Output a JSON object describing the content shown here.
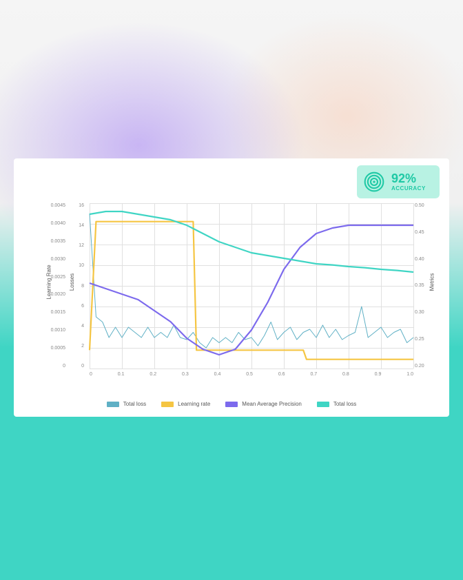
{
  "accuracy": {
    "value": "92%",
    "label": "ACCURACY"
  },
  "axes": {
    "learning_rate_title": "Learning Rate",
    "losses_title": "Losses",
    "metrics_title": "Metrics",
    "learning_rate_ticks": [
      "0.0045",
      "0.0040",
      "0.0035",
      "0.0030",
      "0.0025",
      "0.0020",
      "0.0015",
      "0.0010",
      "0.0005",
      "0"
    ],
    "losses_ticks": [
      "16",
      "14",
      "12",
      "10",
      "8",
      "6",
      "4",
      "2",
      "0"
    ],
    "metrics_ticks": [
      "0.50",
      "0.45",
      "0.40",
      "0.35",
      "0.30",
      "0.25",
      "0.20"
    ],
    "x_ticks": [
      "0",
      "0.1",
      "0.2",
      "0.3",
      "0.4",
      "0.5",
      "0.6",
      "0.7",
      "0.8",
      "0.9",
      "1.0"
    ]
  },
  "legend": {
    "items": [
      {
        "label": "Total  loss",
        "color": "#5fb0c5"
      },
      {
        "label": "Learning rate",
        "color": "#f5c542"
      },
      {
        "label": "Mean Average Precision",
        "color": "#7c6aed"
      },
      {
        "label": "Total loss",
        "color": "#3fd5c4"
      }
    ]
  },
  "chart_data": {
    "type": "line",
    "xlabel": "",
    "xlim": [
      0,
      1.0
    ],
    "axes_config": [
      {
        "name": "Learning Rate",
        "side": "left-outer",
        "range": [
          0,
          0.0045
        ]
      },
      {
        "name": "Losses",
        "side": "left-inner",
        "range": [
          0,
          16
        ]
      },
      {
        "name": "Metrics",
        "side": "right",
        "range": [
          0.2,
          0.5
        ]
      }
    ],
    "series": [
      {
        "name": "Total  loss",
        "axis": "Losses",
        "color": "#5fb0c5",
        "x": [
          0,
          0.02,
          0.04,
          0.06,
          0.08,
          0.1,
          0.12,
          0.14,
          0.16,
          0.18,
          0.2,
          0.22,
          0.24,
          0.26,
          0.28,
          0.3,
          0.32,
          0.34,
          0.36,
          0.38,
          0.4,
          0.42,
          0.44,
          0.46,
          0.48,
          0.5,
          0.52,
          0.54,
          0.56,
          0.58,
          0.6,
          0.62,
          0.64,
          0.66,
          0.68,
          0.7,
          0.72,
          0.74,
          0.76,
          0.78,
          0.8,
          0.82,
          0.84,
          0.86,
          0.88,
          0.9,
          0.92,
          0.94,
          0.96,
          0.98,
          1.0
        ],
        "values": [
          15,
          5,
          4.5,
          3,
          4,
          3,
          4,
          3.5,
          3,
          4,
          3,
          3.5,
          3,
          4.2,
          3,
          2.8,
          3.5,
          2.5,
          2,
          3,
          2.5,
          3,
          2.5,
          3.5,
          2.8,
          3,
          2.2,
          3.2,
          4.5,
          2.8,
          3.5,
          4,
          2.8,
          3.5,
          3.8,
          3,
          4.2,
          3,
          3.8,
          2.8,
          3.2,
          3.5,
          6,
          3,
          3.5,
          4,
          3,
          3.5,
          3.8,
          2.5,
          3
        ]
      },
      {
        "name": "Learning rate",
        "axis": "Learning Rate",
        "color": "#f5c542",
        "x": [
          0,
          0.02,
          0.32,
          0.33,
          0.66,
          0.67,
          1.0
        ],
        "values": [
          0.0005,
          0.004,
          0.004,
          0.0005,
          0.0005,
          0.00025,
          0.00025
        ]
      },
      {
        "name": "Mean Average Precision",
        "axis": "Metrics",
        "color": "#7c6aed",
        "x": [
          0,
          0.05,
          0.1,
          0.15,
          0.2,
          0.25,
          0.3,
          0.35,
          0.4,
          0.45,
          0.5,
          0.55,
          0.6,
          0.65,
          0.7,
          0.75,
          0.8,
          0.85,
          0.9,
          0.95,
          1.0
        ],
        "values": [
          0.355,
          0.345,
          0.335,
          0.325,
          0.305,
          0.285,
          0.255,
          0.235,
          0.225,
          0.235,
          0.27,
          0.32,
          0.38,
          0.42,
          0.445,
          0.455,
          0.46,
          0.46,
          0.46,
          0.46,
          0.46
        ]
      },
      {
        "name": "Total loss",
        "axis": "Metrics",
        "color": "#3fd5c4",
        "x": [
          0,
          0.05,
          0.1,
          0.15,
          0.2,
          0.25,
          0.3,
          0.35,
          0.4,
          0.45,
          0.5,
          0.55,
          0.6,
          0.65,
          0.7,
          0.75,
          0.8,
          0.85,
          0.9,
          0.95,
          1.0
        ],
        "values": [
          0.48,
          0.485,
          0.485,
          0.48,
          0.475,
          0.47,
          0.46,
          0.445,
          0.43,
          0.42,
          0.41,
          0.405,
          0.4,
          0.395,
          0.39,
          0.388,
          0.385,
          0.383,
          0.38,
          0.378,
          0.375
        ]
      }
    ]
  }
}
